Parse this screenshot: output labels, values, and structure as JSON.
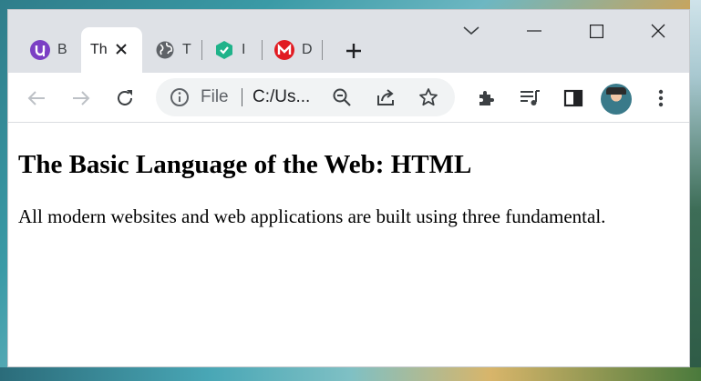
{
  "browser": {
    "tabs": [
      {
        "label": "B",
        "favicon": "upwork-icon",
        "color": "#7b3fc4"
      },
      {
        "label": "Th",
        "favicon": "none",
        "active": true
      },
      {
        "label": "T",
        "favicon": "globe-icon",
        "color": "#5f6368"
      },
      {
        "label": "I",
        "favicon": "green-shield-icon",
        "color": "#1fb38a"
      },
      {
        "label": "D",
        "favicon": "m-logo-icon",
        "color": "#e11b22"
      }
    ],
    "omnibox": {
      "scheme_label": "File",
      "url": "C:/Us..."
    }
  },
  "page": {
    "title": "The Basic Language of the Web: HTML",
    "paragraph": "All modern websites and web applications are built using three fundamental."
  },
  "colors": {
    "titlebar": "#dee1e6",
    "omnibox": "#f1f3f4",
    "icon": "#5f6368"
  }
}
